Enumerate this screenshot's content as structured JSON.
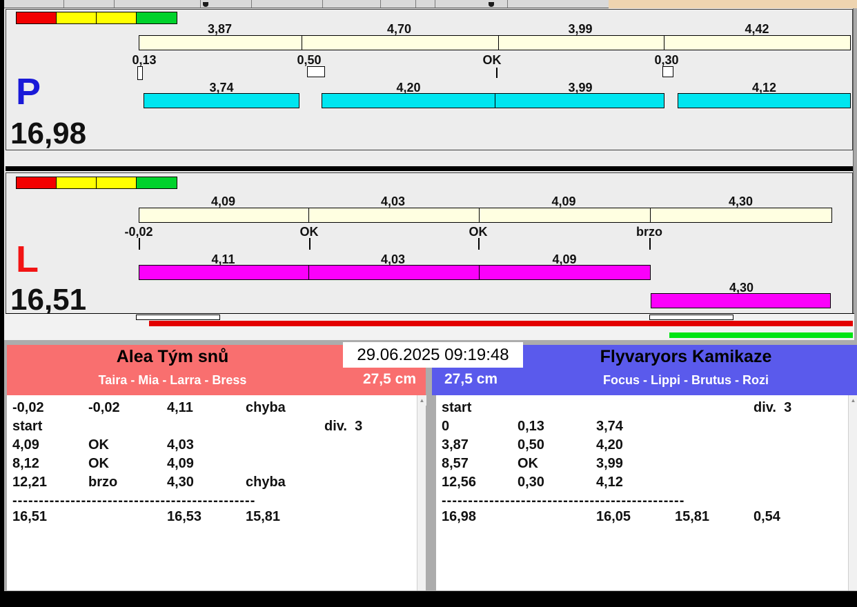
{
  "clock": {
    "datetime": "29.06.2025 09:19:48"
  },
  "lanes": {
    "p": {
      "letter": "P",
      "total": "16,98",
      "splits": [
        "3,87",
        "4,70",
        "3,99",
        "4,42"
      ],
      "passes": [
        "0,13",
        "0,50",
        "OK",
        "0,30"
      ],
      "dogs": [
        "3,74",
        "4,20",
        "3,99",
        "4,12"
      ]
    },
    "l": {
      "letter": "L",
      "total": "16,51",
      "splits": [
        "4,09",
        "4,03",
        "4,09",
        "4,30"
      ],
      "passes": [
        "-0,02",
        "OK",
        "OK",
        "brzo"
      ],
      "dogs": [
        "4,11",
        "4,03",
        "4,09",
        "4,30"
      ]
    }
  },
  "teams": {
    "left": {
      "name": "Alea Tým snů",
      "lineup": "Taira - Mia - Larra - Bress",
      "jump_height": "27,5 cm",
      "log": {
        "rows": [
          [
            "-0,02",
            "-0,02",
            "4,11",
            "chyba",
            ""
          ],
          [
            "start",
            "",
            "",
            "",
            "div.  3"
          ],
          [
            "4,09",
            "OK",
            "4,03",
            "",
            ""
          ],
          [
            "8,12",
            "OK",
            "4,09",
            "",
            ""
          ],
          [
            "12,21",
            "brzo",
            "4,30",
            "chyba",
            ""
          ]
        ],
        "separator": "----------------------------------------------",
        "totals": [
          "16,51",
          "",
          "16,53",
          "15,81",
          ""
        ]
      }
    },
    "right": {
      "name": "Flyvaryors Kamikaze",
      "lineup": "Focus - Lippi - Brutus - Rozi",
      "jump_height": "27,5 cm",
      "log": {
        "rows": [
          [
            "start",
            "",
            "",
            "",
            "div.  3"
          ],
          [
            "0",
            "0,13",
            "3,74",
            "",
            ""
          ],
          [
            "3,87",
            "0,50",
            "4,20",
            "",
            ""
          ],
          [
            "8,57",
            "OK",
            "3,99",
            "",
            ""
          ],
          [
            "12,56",
            "0,30",
            "4,12",
            "",
            ""
          ]
        ],
        "separator": "----------------------------------------------",
        "totals": [
          "16,98",
          "",
          "16,05",
          "15,81",
          "0,54"
        ]
      }
    }
  },
  "icons": {
    "scroll_up": "▲"
  },
  "colors": {
    "split_bar": "#FFFFE1",
    "p_dog_bar": "#00E6F0",
    "l_dog_bar": "#FB00FB",
    "light_red": "#F20000",
    "light_yellow": "#FFFF00",
    "light_green": "#00D22C",
    "progress_red": "#E30000",
    "progress_green": "#00E414",
    "p_letter": "#1A1AD8",
    "l_letter": "#F21414",
    "team_left_bg": "#F96F6F",
    "team_right_bg": "#5A5AEC"
  }
}
